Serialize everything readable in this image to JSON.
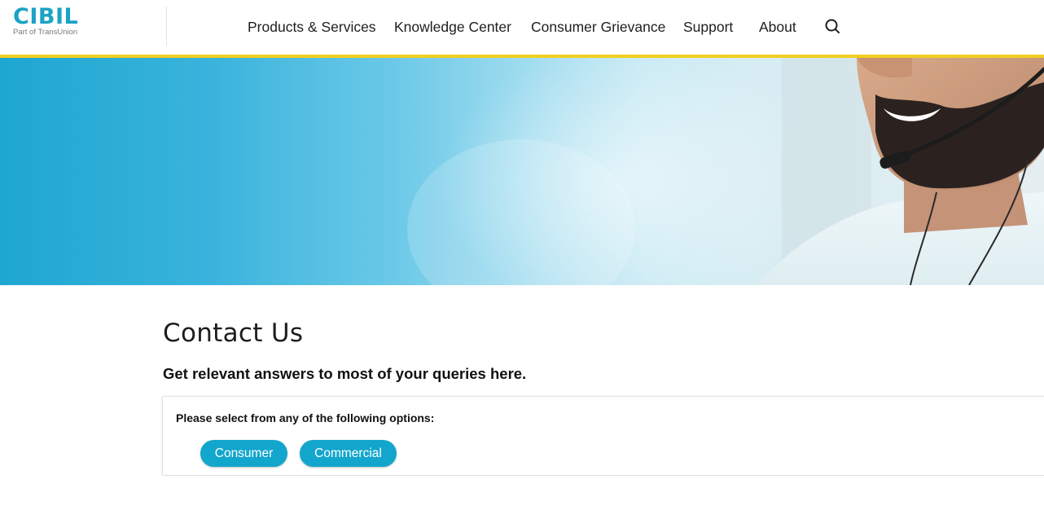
{
  "header": {
    "logo_text": "CIBIL",
    "logo_subtext": "Part of TransUnion",
    "nav": [
      {
        "label": "Products & Services"
      },
      {
        "label": "Knowledge Center"
      },
      {
        "label": "Consumer Grievance"
      },
      {
        "label": "Support"
      },
      {
        "label": "About"
      }
    ],
    "search_icon": "search-icon"
  },
  "colors": {
    "brand": "#1ba3c6",
    "accent_bar": "#f2cf1e",
    "button": "#13a6cd"
  },
  "main": {
    "title": "Contact Us",
    "subtitle": "Get relevant answers to most of your queries here.",
    "options_prompt": "Please select from any of the following options:",
    "options": [
      {
        "label": "Consumer"
      },
      {
        "label": "Commercial"
      }
    ]
  }
}
